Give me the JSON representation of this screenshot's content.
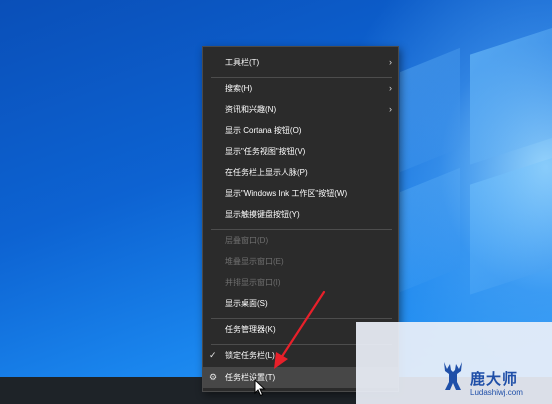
{
  "menu": {
    "items": [
      {
        "label": "工具栏(T)",
        "has_submenu": true,
        "enabled": true
      },
      {
        "label": "搜索(H)",
        "has_submenu": true,
        "enabled": true
      },
      {
        "label": "资讯和兴趣(N)",
        "has_submenu": true,
        "enabled": true
      },
      {
        "label": "显示 Cortana 按钮(O)",
        "enabled": true
      },
      {
        "label": "显示\"任务视图\"按钮(V)",
        "enabled": true
      },
      {
        "label": "在任务栏上显示人脉(P)",
        "enabled": true
      },
      {
        "label": "显示\"Windows Ink 工作区\"按钮(W)",
        "enabled": true
      },
      {
        "label": "显示触摸键盘按钮(Y)",
        "enabled": true
      },
      {
        "label": "层叠窗口(D)",
        "enabled": false
      },
      {
        "label": "堆叠显示窗口(E)",
        "enabled": false
      },
      {
        "label": "并排显示窗口(I)",
        "enabled": false
      },
      {
        "label": "显示桌面(S)",
        "enabled": true
      },
      {
        "label": "任务管理器(K)",
        "enabled": true
      },
      {
        "label": "锁定任务栏(L)",
        "enabled": true,
        "checked": true
      },
      {
        "label": "任务栏设置(T)",
        "enabled": true,
        "icon": "gear-icon",
        "highlighted": true
      }
    ],
    "submenu_arrow": "›",
    "check_mark": "✓",
    "gear_glyph": "⚙"
  },
  "watermark": {
    "title": "鹿大师",
    "url": "Ludashiwj.com"
  },
  "colors": {
    "menu_bg": "#2b2b2b",
    "menu_text": "#ffffff",
    "disabled_text": "#6f6f6f",
    "annotation_arrow": "#e8202a",
    "watermark_text": "#1f4fa8"
  }
}
